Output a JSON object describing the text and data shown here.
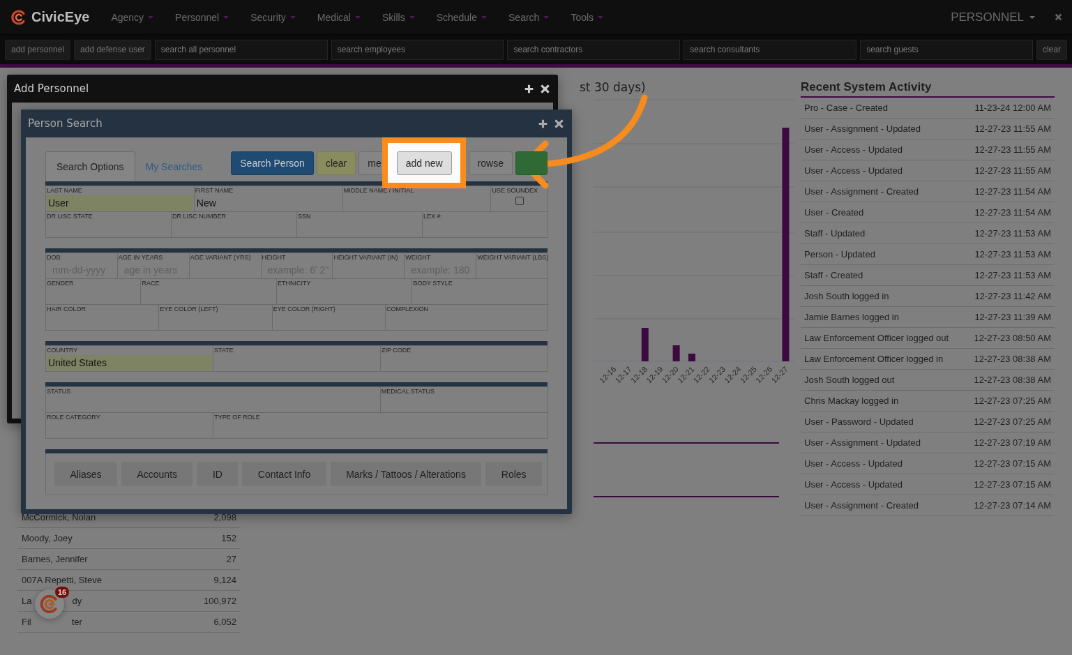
{
  "navbar": {
    "brand": "CivicEye",
    "menu": [
      {
        "label": "Agency"
      },
      {
        "label": "Personnel"
      },
      {
        "label": "Security"
      },
      {
        "label": "Medical"
      },
      {
        "label": "Skills"
      },
      {
        "label": "Schedule"
      },
      {
        "label": "Search"
      },
      {
        "label": "Tools"
      }
    ],
    "user_menu": "PERSONNEL"
  },
  "toolbar": {
    "buttons": [
      "add personnel",
      "add defense user"
    ],
    "searches": [
      {
        "placeholder": "search all personnel"
      },
      {
        "placeholder": "search employees"
      },
      {
        "placeholder": "search contractors"
      },
      {
        "placeholder": "search consultants"
      },
      {
        "placeholder": "search guests"
      }
    ],
    "clear": "clear"
  },
  "left_list": {
    "rows": [
      {
        "name": "McCormick, Nolan",
        "count": "2,098"
      },
      {
        "name": "Moody, Joey",
        "count": "152"
      },
      {
        "name": "Barnes, Jennifer",
        "count": "27"
      },
      {
        "name": "007A Repetti, Steve",
        "count": "9,124"
      },
      {
        "name": "La",
        "name_tail": "dy",
        "count": "100,972"
      },
      {
        "name": "Fil",
        "name_tail": "ter",
        "count": "6,052"
      }
    ]
  },
  "chart_panel": {
    "title": "st 30 days)",
    "x_labels": [
      "12-16",
      "12-17",
      "12-18",
      "12-19",
      "12-20",
      "12-21",
      "12-22",
      "12-23",
      "12-24",
      "12-25",
      "12-26",
      "12-27"
    ]
  },
  "activity": {
    "title": "Recent System Activity",
    "rows": [
      {
        "event": "Pro - Case - Created",
        "time": "11-23-24 12:00 AM"
      },
      {
        "event": "User - Assignment - Updated",
        "time": "12-27-23 11:55 AM"
      },
      {
        "event": "User - Access - Updated",
        "time": "12-27-23 11:55 AM"
      },
      {
        "event": "User - Access - Updated",
        "time": "12-27-23 11:55 AM"
      },
      {
        "event": "User - Assignment - Created",
        "time": "12-27-23 11:54 AM"
      },
      {
        "event": "User - Created",
        "time": "12-27-23 11:54 AM"
      },
      {
        "event": "Staff - Updated",
        "time": "12-27-23 11:53 AM"
      },
      {
        "event": "Person - Updated",
        "time": "12-27-23 11:53 AM"
      },
      {
        "event": "Staff - Created",
        "time": "12-27-23 11:53 AM"
      },
      {
        "event": "Josh South logged in",
        "time": "12-27-23 11:42 AM"
      },
      {
        "event": "Jamie Barnes logged in",
        "time": "12-27-23 11:39 AM"
      },
      {
        "event": "Law Enforcement Officer logged out",
        "time": "12-27-23 08:50 AM"
      },
      {
        "event": "Law Enforcement Officer logged in",
        "time": "12-27-23 08:38 AM"
      },
      {
        "event": "Josh South logged out",
        "time": "12-27-23 08:38 AM"
      },
      {
        "event": "Chris Mackay logged in",
        "time": "12-27-23 07:25 AM"
      },
      {
        "event": "User - Password - Updated",
        "time": "12-27-23 07:25 AM"
      },
      {
        "event": "User - Assignment - Updated",
        "time": "12-27-23 07:19 AM"
      },
      {
        "event": "User - Access - Updated",
        "time": "12-27-23 07:15 AM"
      },
      {
        "event": "User - Access - Updated",
        "time": "12-27-23 07:15 AM"
      },
      {
        "event": "User - Assignment - Created",
        "time": "12-27-23 07:14 AM"
      }
    ]
  },
  "add_personnel_window": {
    "title": "Add Personnel"
  },
  "person_search_window": {
    "title": "Person Search",
    "tabs": [
      {
        "label": "Search Options",
        "selected": true
      },
      {
        "label": "My Searches",
        "selected": false
      }
    ],
    "actions": [
      {
        "label": "Search Person",
        "kind": "primary",
        "highlighted": false
      },
      {
        "label": "clear",
        "kind": "warning",
        "highlighted": false
      },
      {
        "label": "me",
        "kind": "default",
        "highlighted": false
      },
      {
        "label": "add new",
        "kind": "default",
        "highlighted": true
      },
      {
        "label": "rowse",
        "kind": "default",
        "highlighted": false
      },
      {
        "kind": "success",
        "highlighted": false
      }
    ],
    "sections": [
      {
        "lines": [
          {
            "fields": [
              {
                "label": "LAST NAME",
                "kind": "text",
                "value": "User",
                "highlighted": true
              },
              {
                "label": "FIRST NAME",
                "kind": "text",
                "value": "New",
                "highlighted": false
              },
              {
                "label": "MIDDLE NAME / INITIAL",
                "kind": "text",
                "highlighted": false
              },
              {
                "label": "USE SOUNDEX",
                "kind": "checkbox",
                "checked": false
              }
            ]
          },
          {
            "fields": [
              {
                "label": "DR LISC STATE",
                "kind": "text",
                "highlighted": false
              },
              {
                "label": "DR LISC NUMBER",
                "kind": "text",
                "highlighted": false
              },
              {
                "label": "SSN",
                "kind": "text",
                "highlighted": false
              },
              {
                "label": "LEX #:",
                "kind": "text",
                "highlighted": false
              }
            ]
          }
        ]
      },
      {
        "lines": [
          {
            "fields": [
              {
                "label": "DOB",
                "kind": "text",
                "placeholder": "mm-dd-yyyy",
                "highlighted": false
              },
              {
                "label": "AGE IN YEARS",
                "kind": "text",
                "placeholder": "age in years",
                "highlighted": false
              },
              {
                "label": "AGE VARIANT (YRS)",
                "kind": "text",
                "highlighted": false
              },
              {
                "label": "HEIGHT",
                "kind": "text",
                "placeholder": "example: 6' 2\"",
                "highlighted": false
              },
              {
                "label": "HEIGHT VARIANT (IN)",
                "kind": "text",
                "highlighted": false
              },
              {
                "label": "WEIGHT",
                "kind": "text",
                "placeholder": "example: 180",
                "highlighted": false
              },
              {
                "label": "WEIGHT VARIANT (LBS)",
                "kind": "text",
                "highlighted": false
              }
            ]
          },
          {
            "fields": [
              {
                "label": "GENDER",
                "kind": "text",
                "highlighted": false
              },
              {
                "label": "RACE",
                "kind": "text",
                "highlighted": false
              },
              {
                "label": "ETHNICITY",
                "kind": "text",
                "highlighted": false
              },
              {
                "label": "BODY STYLE",
                "kind": "text",
                "highlighted": false
              }
            ]
          },
          {
            "fields": [
              {
                "label": "HAIR COLOR",
                "kind": "text",
                "highlighted": false
              },
              {
                "label": "EYE COLOR (LEFT)",
                "kind": "text",
                "highlighted": false
              },
              {
                "label": "EYE COLOR (RIGHT)",
                "kind": "text",
                "highlighted": false
              },
              {
                "label": "COMPLEXION",
                "kind": "text",
                "highlighted": false
              }
            ]
          }
        ]
      },
      {
        "lines": [
          {
            "fields": [
              {
                "label": "COUNTRY",
                "kind": "text",
                "value": "United States",
                "highlighted": true
              },
              {
                "label": "STATE",
                "kind": "text",
                "highlighted": false
              },
              {
                "label": "ZIP CODE",
                "kind": "text",
                "highlighted": false
              }
            ]
          }
        ]
      },
      {
        "lines": [
          {
            "fields": [
              {
                "label": "STATUS",
                "kind": "text",
                "highlighted": false
              },
              {
                "label": "MEDICAL STATUS",
                "kind": "text",
                "highlighted": false
              }
            ]
          },
          {
            "fields": [
              {
                "label": "ROLE CATEGORY",
                "kind": "text",
                "highlighted": false
              },
              {
                "label": "TYPE OF ROLE",
                "kind": "text",
                "highlighted": false
              }
            ]
          }
        ]
      }
    ],
    "subtabs": [
      "Aliases",
      "Accounts",
      "ID",
      "Contact Info",
      "Marks / Tattoos / Alterations",
      "Roles"
    ]
  },
  "notification": {
    "count": "16"
  }
}
